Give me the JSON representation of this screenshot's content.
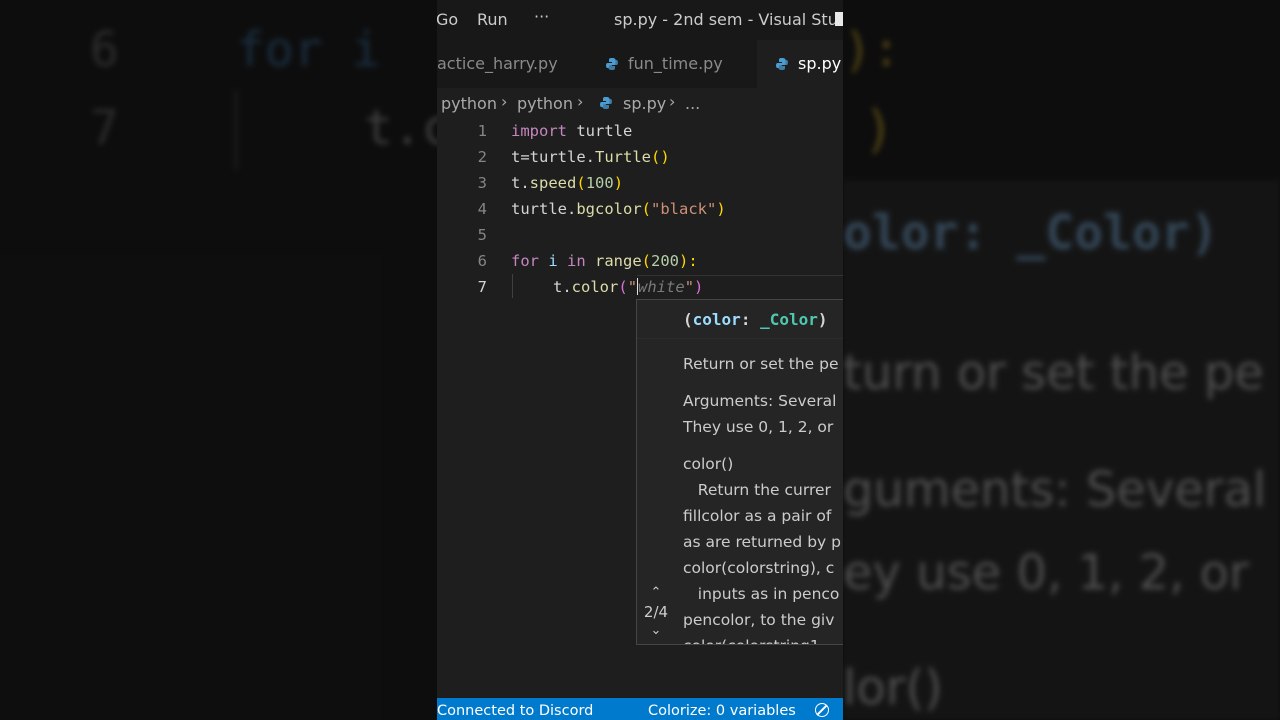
{
  "titlebar": {
    "menu_go": "Go",
    "menu_run": "Run",
    "more": "···",
    "window_title": "sp.py - 2nd sem - Visual Stu..."
  },
  "tabs": [
    {
      "label": "actice_harry.py",
      "active": false
    },
    {
      "label": "fun_time.py",
      "active": false
    },
    {
      "label": "sp.py",
      "active": true
    }
  ],
  "breadcrumb": [
    "python",
    "python",
    "sp.py",
    "..."
  ],
  "code": {
    "line_numbers": [
      "1",
      "2",
      "3",
      "4",
      "5",
      "6",
      "7"
    ],
    "line1": {
      "kw": "import",
      "rest": " turtle"
    },
    "line2": {
      "a": "t=turtle.",
      "fn": "Turtle",
      "paren": "()"
    },
    "line3": {
      "a": "t.",
      "fn": "speed",
      "open": "(",
      "num": "100",
      "close": ")"
    },
    "line4": {
      "a": "turtle.",
      "fn": "bgcolor",
      "open": "(",
      "str": "\"black\"",
      "close": ")"
    },
    "line6": {
      "kw_for": "for",
      "var": " i ",
      "kw_in": "in",
      "fn": " range",
      "open": "(",
      "num": "200",
      "close": "):"
    },
    "line7": {
      "a": "t.",
      "fn": "color",
      "open": "(",
      "quote1": "\"",
      "ghost": "white",
      "quote2": "\"",
      "close": ")"
    }
  },
  "hover": {
    "sig_open": "(",
    "param": "color",
    "colon": ": ",
    "type": "_Color",
    "sig_close": ")",
    "lines": [
      "Return or set the pe",
      "Arguments: Several",
      "They use 0, 1, 2, or",
      "color()",
      "   Return the currer",
      "fillcolor as a pair of",
      "as are returned by p",
      "color(colorstring), c",
      "   inputs as in penco",
      "pencolor, to the giv",
      "color(colorstring1,"
    ],
    "nav_up": "⌃",
    "overload": "2/4",
    "nav_down": "⌄"
  },
  "status": {
    "discord": "Connected to Discord",
    "colorize": "Colorize: 0 variables"
  },
  "backdrop": {
    "left_ln6": "6",
    "left_ln7": "7",
    "left_code6": "for i",
    "left_code7": "t.c",
    "right_paren": "):",
    "right_bracket": ")",
    "right_sig": "olor: _Color)",
    "right_l1": "turn or set the pe",
    "right_l2": "guments: Several",
    "right_l3": "ey use 0, 1, 2, or",
    "right_l4": "lor()"
  },
  "colors": {
    "editor_bg": "#1e1e1e",
    "status_bg": "#007acc",
    "keyword": "#569cd6",
    "function": "#dcdcaa",
    "number": "#b5cea8",
    "string": "#ce9178",
    "bracket": "#ffd700"
  }
}
